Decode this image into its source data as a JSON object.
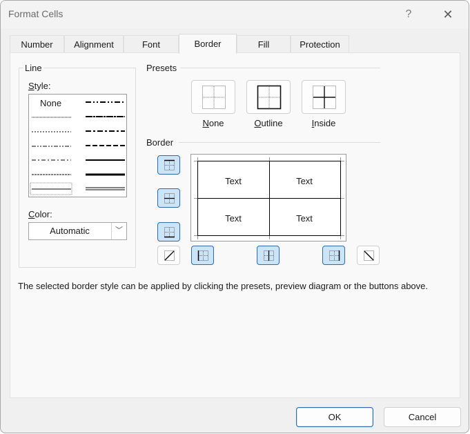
{
  "window": {
    "title": "Format Cells",
    "help_glyph": "?",
    "close_glyph": "✕"
  },
  "tabs": [
    {
      "label": "Number",
      "active": false
    },
    {
      "label": "Alignment",
      "active": false
    },
    {
      "label": "Font",
      "active": false
    },
    {
      "label": "Border",
      "active": true
    },
    {
      "label": "Fill",
      "active": false
    },
    {
      "label": "Protection",
      "active": false
    }
  ],
  "line": {
    "group_title": "Line",
    "style_label_key": "S",
    "style_label_rest": "tyle:",
    "styles_left": [
      "None",
      "hair",
      "dotted",
      "dash-dot-dot",
      "dash-dot",
      "dashed",
      "thin"
    ],
    "styles_right": [
      "medium-dash-dot-dot",
      "slanted-dash-dot",
      "medium-dash-dot",
      "medium-dashed",
      "medium",
      "thick",
      "double"
    ],
    "selected_style": "thin",
    "color_label_key": "C",
    "color_label_rest": "olor:",
    "color_value": "Automatic",
    "color_arrow": "﹀"
  },
  "presets": {
    "title": "Presets",
    "items": [
      {
        "key": "N",
        "rest": "one"
      },
      {
        "key": "O",
        "rest": "utline"
      },
      {
        "key": "I",
        "rest": "nside"
      }
    ]
  },
  "border": {
    "title": "Border",
    "preview_cells": [
      "Text",
      "Text",
      "Text",
      "Text"
    ],
    "buttons": {
      "top": true,
      "inside_horizontal": true,
      "bottom": true,
      "diagonal_up": false,
      "left": true,
      "inside_vertical": true,
      "right": true,
      "diagonal_down": false
    }
  },
  "hint": "The selected border style can be applied by clicking the presets, preview diagram or the buttons above.",
  "footer": {
    "ok_label": "OK",
    "cancel_label": "Cancel"
  }
}
